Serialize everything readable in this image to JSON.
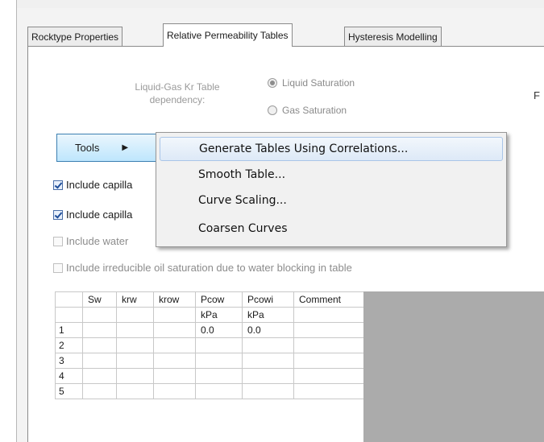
{
  "tabs": [
    {
      "label": "Rocktype Properties",
      "active": false
    },
    {
      "label": "Relative Permeability Tables",
      "active": true
    },
    {
      "label": "Hysteresis Modelling",
      "active": false
    }
  ],
  "dependency": {
    "label_line1": "Liquid-Gas Kr Table",
    "label_line2": "dependency:",
    "options": [
      {
        "label": "Liquid Saturation",
        "selected": true
      },
      {
        "label": "Gas Saturation",
        "selected": false
      }
    ]
  },
  "right_edge_text": "F",
  "tools": {
    "label": "Tools",
    "arrow": "▶"
  },
  "checkboxes": [
    {
      "label": "Include capilla",
      "checked": true,
      "enabled": true
    },
    {
      "label": "Include capilla",
      "checked": true,
      "enabled": true
    },
    {
      "label": "Include water",
      "checked": false,
      "enabled": false
    },
    {
      "label": "Include irreducible oil saturation due to water blocking in table",
      "checked": false,
      "enabled": false
    }
  ],
  "menu": {
    "items": [
      {
        "label": "Generate Tables Using Correlations...",
        "highlighted": true
      },
      {
        "label": "Smooth Table...",
        "highlighted": false
      },
      {
        "label": "Curve Scaling...",
        "highlighted": false
      },
      {
        "label": "Coarsen Curves",
        "highlighted": false
      }
    ]
  },
  "table": {
    "columns": [
      "",
      "Sw",
      "krw",
      "krow",
      "Pcow",
      "Pcowi",
      "Comment"
    ],
    "units": [
      "",
      "",
      "",
      "",
      "kPa",
      "kPa",
      ""
    ],
    "rows": [
      [
        "1",
        "",
        "",
        "",
        "0.0",
        "0.0",
        ""
      ],
      [
        "2",
        "",
        "",
        "",
        "",
        "",
        ""
      ],
      [
        "3",
        "",
        "",
        "",
        "",
        "",
        ""
      ],
      [
        "4",
        "",
        "",
        "",
        "",
        "",
        ""
      ],
      [
        "5",
        "",
        "",
        "",
        "",
        "",
        ""
      ]
    ]
  }
}
